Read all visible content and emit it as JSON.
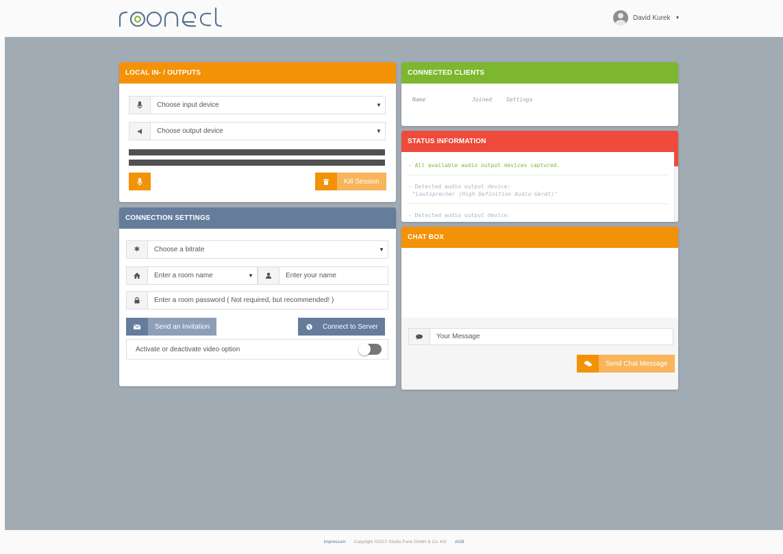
{
  "header": {
    "logo_text": "roonect",
    "user_name": "David Kurek"
  },
  "local_io": {
    "title": "LOCAL IN- / OUTPUTS",
    "input_device_placeholder": "Choose input device",
    "output_device_placeholder": "Choose output device",
    "kill_session_label": "Kill Session"
  },
  "connection_settings": {
    "title": "CONNECTION SETTINGS",
    "bitrate_placeholder": "Choose a bitrate",
    "room_name_placeholder": "Enter a room name",
    "your_name_placeholder": "Enter your name",
    "room_password_placeholder": "Enter a room password ( Not required, but recommended! )",
    "send_invitation_label": "Send an Invitation",
    "connect_label": "Connect to Server",
    "video_option_label": "Activate or deactivate video option"
  },
  "connected_clients": {
    "title": "CONNECTED CLIENTS",
    "columns": [
      "Name",
      "Joined",
      "Settings"
    ]
  },
  "status_information": {
    "title": "STATUS INFORMATION",
    "entries": [
      {
        "text": "- All available audio output devices captured."
      },
      {
        "text": "- Detected audio output device:",
        "detail": "\"Lautsprecher (High Definition Audio-Gerät)\""
      },
      {
        "text": "- Detected audio output device:"
      }
    ]
  },
  "chat_box": {
    "title": "CHAT BOX",
    "message_placeholder": "Your Message",
    "send_label": "Send Chat Message"
  },
  "footer": {
    "impressum": "Impressum",
    "copyright": "Copyright ©2017 Studio Funk GmbH & Co. KG",
    "agb": "AGB"
  },
  "colors": {
    "orange": "#f39207",
    "slate_blue": "#667c9b",
    "green": "#7db730",
    "red": "#ee4b3a",
    "background": "#a1abb3"
  },
  "toggles": {
    "video_enabled": false
  }
}
